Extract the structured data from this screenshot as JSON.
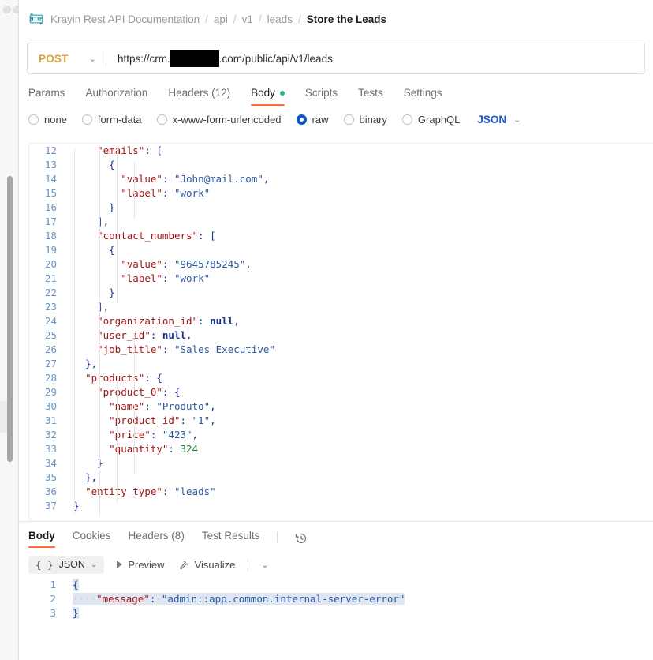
{
  "window": {
    "app": "postman-api-client"
  },
  "breadcrumb": {
    "icon": "http-protocol-icon",
    "items": [
      {
        "label": "Krayin Rest API Documentation",
        "current": false
      },
      {
        "label": "api",
        "current": false
      },
      {
        "label": "v1",
        "current": false
      },
      {
        "label": "leads",
        "current": false
      },
      {
        "label": "Store the Leads",
        "current": true
      }
    ],
    "separator": "/"
  },
  "request": {
    "method": "POST",
    "method_caret": "⌄",
    "url_prefix": "https://crm.",
    "url_redacted": true,
    "url_suffix": ".com/public/api/v1/leads",
    "tabs": [
      {
        "label": "Params",
        "active": false,
        "dot": false
      },
      {
        "label": "Authorization",
        "active": false,
        "dot": false
      },
      {
        "label": "Headers (12)",
        "active": false,
        "dot": false
      },
      {
        "label": "Body",
        "active": true,
        "dot": true
      },
      {
        "label": "Scripts",
        "active": false,
        "dot": false
      },
      {
        "label": "Tests",
        "active": false,
        "dot": false
      },
      {
        "label": "Settings",
        "active": false,
        "dot": false
      }
    ],
    "body_types": [
      {
        "label": "none",
        "selected": false
      },
      {
        "label": "form-data",
        "selected": false
      },
      {
        "label": "x-www-form-urlencoded",
        "selected": false
      },
      {
        "label": "raw",
        "selected": true
      },
      {
        "label": "binary",
        "selected": false
      },
      {
        "label": "GraphQL",
        "selected": false
      }
    ],
    "raw_format": "JSON",
    "raw_format_caret": "⌄"
  },
  "request_body": {
    "first_visible_line": 12,
    "lines": [
      {
        "n": 12,
        "indent": 2,
        "tokens": [
          {
            "t": "key",
            "v": "\"emails\""
          },
          {
            "t": "punc",
            "v": ": ["
          }
        ]
      },
      {
        "n": 13,
        "indent": 3,
        "tokens": [
          {
            "t": "punc",
            "v": "{"
          }
        ]
      },
      {
        "n": 14,
        "indent": 4,
        "tokens": [
          {
            "t": "key",
            "v": "\"value\""
          },
          {
            "t": "punc",
            "v": ": "
          },
          {
            "t": "str",
            "v": "\"John@mail.com\""
          },
          {
            "t": "punc",
            "v": ","
          }
        ]
      },
      {
        "n": 15,
        "indent": 4,
        "tokens": [
          {
            "t": "key",
            "v": "\"label\""
          },
          {
            "t": "punc",
            "v": ": "
          },
          {
            "t": "str",
            "v": "\"work\""
          }
        ]
      },
      {
        "n": 16,
        "indent": 3,
        "tokens": [
          {
            "t": "punc",
            "v": "}"
          }
        ]
      },
      {
        "n": 17,
        "indent": 2,
        "tokens": [
          {
            "t": "punc",
            "v": "],"
          }
        ]
      },
      {
        "n": 18,
        "indent": 2,
        "tokens": [
          {
            "t": "key",
            "v": "\"contact_numbers\""
          },
          {
            "t": "punc",
            "v": ": ["
          }
        ]
      },
      {
        "n": 19,
        "indent": 3,
        "tokens": [
          {
            "t": "punc",
            "v": "{"
          }
        ]
      },
      {
        "n": 20,
        "indent": 4,
        "tokens": [
          {
            "t": "key",
            "v": "\"value\""
          },
          {
            "t": "punc",
            "v": ": "
          },
          {
            "t": "str",
            "v": "\"9645785245\""
          },
          {
            "t": "punc",
            "v": ","
          }
        ]
      },
      {
        "n": 21,
        "indent": 4,
        "tokens": [
          {
            "t": "key",
            "v": "\"label\""
          },
          {
            "t": "punc",
            "v": ": "
          },
          {
            "t": "str",
            "v": "\"work\""
          }
        ]
      },
      {
        "n": 22,
        "indent": 3,
        "tokens": [
          {
            "t": "punc",
            "v": "}"
          }
        ]
      },
      {
        "n": 23,
        "indent": 2,
        "tokens": [
          {
            "t": "punc",
            "v": "],"
          }
        ]
      },
      {
        "n": 24,
        "indent": 2,
        "tokens": [
          {
            "t": "key",
            "v": "\"organization_id\""
          },
          {
            "t": "punc",
            "v": ": "
          },
          {
            "t": "null",
            "v": "null"
          },
          {
            "t": "punc",
            "v": ","
          }
        ]
      },
      {
        "n": 25,
        "indent": 2,
        "tokens": [
          {
            "t": "key",
            "v": "\"user_id\""
          },
          {
            "t": "punc",
            "v": ": "
          },
          {
            "t": "null",
            "v": "null"
          },
          {
            "t": "punc",
            "v": ","
          }
        ]
      },
      {
        "n": 26,
        "indent": 2,
        "tokens": [
          {
            "t": "key",
            "v": "\"job_title\""
          },
          {
            "t": "punc",
            "v": ": "
          },
          {
            "t": "str",
            "v": "\"Sales Executive\""
          }
        ]
      },
      {
        "n": 27,
        "indent": 1,
        "tokens": [
          {
            "t": "punc",
            "v": "},"
          }
        ]
      },
      {
        "n": 28,
        "indent": 1,
        "tokens": [
          {
            "t": "key",
            "v": "\"products\""
          },
          {
            "t": "punc",
            "v": ": {"
          }
        ]
      },
      {
        "n": 29,
        "indent": 2,
        "tokens": [
          {
            "t": "key",
            "v": "\"product_0\""
          },
          {
            "t": "punc",
            "v": ": {"
          }
        ]
      },
      {
        "n": 30,
        "indent": 3,
        "tokens": [
          {
            "t": "key",
            "v": "\"name\""
          },
          {
            "t": "punc",
            "v": ": "
          },
          {
            "t": "str",
            "v": "\"Produto\""
          },
          {
            "t": "punc",
            "v": ","
          }
        ]
      },
      {
        "n": 31,
        "indent": 3,
        "tokens": [
          {
            "t": "key",
            "v": "\"product_id\""
          },
          {
            "t": "punc",
            "v": ": "
          },
          {
            "t": "str",
            "v": "\"1\""
          },
          {
            "t": "punc",
            "v": ","
          }
        ]
      },
      {
        "n": 32,
        "indent": 3,
        "tokens": [
          {
            "t": "key",
            "v": "\"price\""
          },
          {
            "t": "punc",
            "v": ": "
          },
          {
            "t": "str",
            "v": "\"423\""
          },
          {
            "t": "punc",
            "v": ","
          }
        ]
      },
      {
        "n": 33,
        "indent": 3,
        "tokens": [
          {
            "t": "key",
            "v": "\"quantity\""
          },
          {
            "t": "punc",
            "v": ": "
          },
          {
            "t": "num",
            "v": "324"
          }
        ]
      },
      {
        "n": 34,
        "indent": 2,
        "tokens": [
          {
            "t": "punc",
            "v": "}"
          }
        ]
      },
      {
        "n": 35,
        "indent": 1,
        "tokens": [
          {
            "t": "punc",
            "v": "},"
          }
        ]
      },
      {
        "n": 36,
        "indent": 1,
        "tokens": [
          {
            "t": "key",
            "v": "\"entity_type\""
          },
          {
            "t": "punc",
            "v": ": "
          },
          {
            "t": "str",
            "v": "\"leads\""
          }
        ]
      },
      {
        "n": 37,
        "indent": 0,
        "tokens": [
          {
            "t": "punc",
            "v": "}"
          }
        ]
      }
    ]
  },
  "response": {
    "tabs": [
      {
        "label": "Body",
        "active": true
      },
      {
        "label": "Cookies",
        "active": false
      },
      {
        "label": "Headers (8)",
        "active": false
      },
      {
        "label": "Test Results",
        "active": false
      }
    ],
    "history_icon": "history-clock-icon",
    "toolbar": {
      "format_label": "JSON",
      "format_braces": "{ }",
      "format_caret": "⌄",
      "preview_label": "Preview",
      "visualize_label": "Visualize",
      "more_caret": "⌄"
    },
    "body_lines": [
      {
        "n": 1,
        "tokens": [
          {
            "t": "punc",
            "v": "{",
            "sel": true
          }
        ]
      },
      {
        "n": 2,
        "tokens": [
          {
            "t": "ws",
            "v": "····",
            "sel": true
          },
          {
            "t": "key",
            "v": "\"message\"",
            "sel": true
          },
          {
            "t": "punc",
            "v": ":",
            "sel": true
          },
          {
            "t": "ws",
            "v": "·",
            "sel": true
          },
          {
            "t": "str",
            "v": "\"admin::app.common.internal-server-error\"",
            "sel": true
          }
        ]
      },
      {
        "n": 3,
        "tokens": [
          {
            "t": "punc",
            "v": "}",
            "sel": true
          }
        ]
      }
    ]
  },
  "colors": {
    "accent_orange": "#ff6c37",
    "method_post": "#d9a43b",
    "radio_selected_blue": "#0a56c9",
    "json_label_blue": "#1858c8",
    "body_dot_green": "#22b573",
    "json_key": "#a31515",
    "json_string": "#295a9e",
    "json_number": "#1a7f37",
    "json_punctuation": "#18348f",
    "line_number": "#6b93c4",
    "selection": "#dfe6f2"
  }
}
